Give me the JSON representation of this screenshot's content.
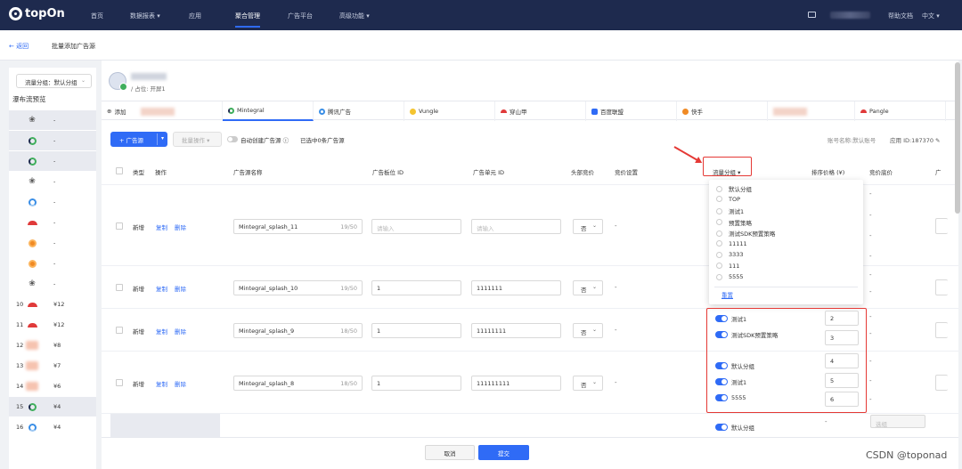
{
  "nav": {
    "brand": "topOn",
    "items": [
      {
        "label": "首页"
      },
      {
        "label": "数据报表 ▾"
      },
      {
        "label": "应用"
      },
      {
        "label": "聚合管理"
      },
      {
        "label": "广告平台"
      },
      {
        "label": "高级功能 ▾"
      }
    ],
    "help": "帮助文档",
    "lang": "中文 ▾"
  },
  "subheader": {
    "back": "← 返回",
    "title": "批量添加广告源"
  },
  "sidebar": {
    "group_select": "流量分组：默认分组",
    "waterfall_title": "瀑布流预览",
    "rows": [
      {
        "num": "",
        "icon": "kuaishou-icon",
        "price": "-",
        "gray": true
      },
      {
        "num": "",
        "icon": "mintegral-icon",
        "price": "-",
        "gray": true
      },
      {
        "num": "",
        "icon": "mintegral-icon",
        "price": "-",
        "gray": true
      },
      {
        "num": "",
        "icon": "kuaishou-icon",
        "price": "-",
        "gray": false
      },
      {
        "num": "",
        "icon": "tencent-icon",
        "price": "-",
        "gray": false
      },
      {
        "num": "",
        "icon": "pangle-icon",
        "price": "-",
        "gray": false
      },
      {
        "num": "",
        "icon": "kuaishou-icon",
        "price": "-",
        "gray": false
      },
      {
        "num": "",
        "icon": "kuaishou-icon",
        "price": "-",
        "gray": false
      },
      {
        "num": "",
        "icon": "kuaishou-icon",
        "price": "-",
        "gray": false
      },
      {
        "num": "10",
        "icon": "pangle-icon",
        "price": "¥12",
        "gray": false
      },
      {
        "num": "11",
        "icon": "pangle-icon",
        "price": "¥12",
        "gray": false
      },
      {
        "num": "12",
        "icon": "blurred-icon",
        "price": "¥8",
        "gray": false
      },
      {
        "num": "13",
        "icon": "blurred-icon",
        "price": "¥7",
        "gray": false
      },
      {
        "num": "14",
        "icon": "blurred-icon",
        "price": "¥6",
        "gray": false
      },
      {
        "num": "15",
        "icon": "mintegral-icon",
        "price": "¥4",
        "gray": true
      },
      {
        "num": "16",
        "icon": "tencent-icon",
        "price": "¥4",
        "gray": false
      }
    ]
  },
  "app": {
    "placement": "/ 占位: 开屏1"
  },
  "tabs": [
    {
      "label": "添加",
      "icon": "add-icon"
    },
    {
      "label": "",
      "icon": "blurred"
    },
    {
      "label": "Mintegral",
      "icon": "mintegral",
      "active": true
    },
    {
      "label": "腾讯广告",
      "icon": "tencent"
    },
    {
      "label": "Vungle",
      "icon": "vungle"
    },
    {
      "label": "穿山甲",
      "icon": "pangle"
    },
    {
      "label": "百度联盟",
      "icon": "baidu"
    },
    {
      "label": "快手",
      "icon": "kuaishou"
    },
    {
      "label": "",
      "icon": "blurred"
    },
    {
      "label": "Pangle",
      "icon": "pangle"
    }
  ],
  "toolbar": {
    "add_source": "+ 广告源",
    "batch_ops": "批量操作 ▾",
    "auto_create": "自动创建广告源 ⓘ",
    "selected": "已选中0条广告源",
    "account": "账号名称:默认账号",
    "app_id": "应用 ID:187370 ✎"
  },
  "table": {
    "headers": {
      "type": "类型",
      "action": "操作",
      "name": "广告源名称",
      "slot_id": "广告板位 ID",
      "unit_id": "广告单元 ID",
      "header_bid": "头部竞价",
      "bid_setting": "竞价设置",
      "traffic_group": "流量分组 ▾",
      "sort_price": "排序价格 (¥)",
      "bid_price": "竞价底价",
      "trunc": "广"
    },
    "rows": [
      {
        "type": "新增",
        "copy": "复制",
        "delete": "删除",
        "name": "Mintegral_splash_11",
        "count": "19/50",
        "slot": "请输入",
        "unit": "请输入",
        "slot_ph": true,
        "bid": "否"
      },
      {
        "type": "新增",
        "copy": "复制",
        "delete": "删除",
        "name": "Mintegral_splash_10",
        "count": "19/50",
        "slot": "1",
        "unit": "1111111",
        "slot_ph": false,
        "bid": "否"
      },
      {
        "type": "新增",
        "copy": "复制",
        "delete": "删除",
        "name": "Mintegral_splash_9",
        "count": "18/50",
        "slot": "1",
        "unit": "11111111",
        "slot_ph": false,
        "bid": "否"
      },
      {
        "type": "新增",
        "copy": "复制",
        "delete": "删除",
        "name": "Mintegral_splash_8",
        "count": "18/50",
        "slot": "1",
        "unit": "111111111",
        "slot_ph": false,
        "bid": "否"
      }
    ],
    "dash": "-",
    "last_row_select": "选组"
  },
  "traffic_dropdown": {
    "options": [
      "默认分组",
      "TOP",
      "测试1",
      "预置策略",
      "测试SDK预置策略",
      "11111",
      "3333",
      "111",
      "5555"
    ],
    "reset": "重置"
  },
  "group_assignments": [
    {
      "name": "测试1",
      "price": "2"
    },
    {
      "name": "测试SDK预置策略",
      "price": "3"
    },
    {
      "name": "默认分组",
      "price": "4"
    },
    {
      "name": "测试1",
      "price": "5"
    },
    {
      "name": "5555",
      "price": "6"
    }
  ],
  "last_row_group": "默认分组",
  "footer": {
    "cancel": "取消",
    "submit": "提交"
  },
  "watermark": "CSDN @toponad",
  "colors": {
    "nav_bg": "#1e2a4e",
    "primary": "#2f6bf6",
    "highlight": "#e53935"
  }
}
